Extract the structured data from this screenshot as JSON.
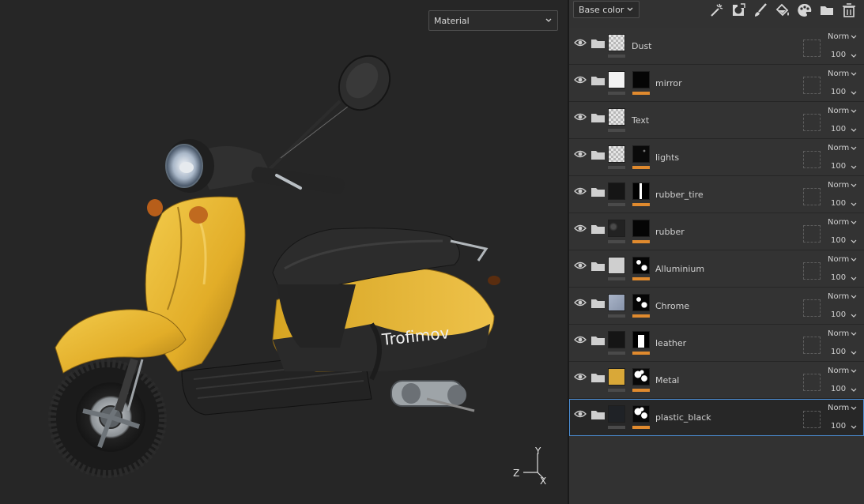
{
  "viewport": {
    "mode_dropdown": {
      "value": "Material"
    },
    "scene": {
      "brand_decal": "Trofimov",
      "colors": {
        "body": "#e7b52c",
        "body_shadow": "#b6861a",
        "seat": "#2c2c2c",
        "rubber": "#1d1d1d",
        "chrome": "#b7bcc2",
        "indicator": "#c0651b",
        "background": "#262626"
      }
    },
    "axis_gizmo": {
      "y_label": "Y",
      "z_label": "Z",
      "x_label": "X"
    }
  },
  "panel": {
    "channel_dropdown": {
      "value": "Base color"
    },
    "toolbar_icons": [
      "magic-wand-icon",
      "mask-icon",
      "paint-brush-icon",
      "fill-bucket-icon",
      "palette-icon",
      "folder-icon",
      "trash-icon"
    ],
    "accent_color": "#e08a2e",
    "selection_color": "#4b8bd0",
    "layers": [
      {
        "name": "Dust",
        "thumb": "checker",
        "mask": "none",
        "blend": "Norm",
        "opacity": "100"
      },
      {
        "name": "mirror",
        "thumb": "white",
        "mask": "black",
        "blend": "Norm",
        "opacity": "100"
      },
      {
        "name": "Text",
        "thumb": "checker",
        "mask": "none",
        "blend": "Norm",
        "opacity": "100"
      },
      {
        "name": "lights",
        "thumb": "checker",
        "mask": "dark-speck",
        "blend": "Norm",
        "opacity": "100"
      },
      {
        "name": "rubber_tire",
        "thumb": "dark",
        "mask": "white-line",
        "blend": "Norm",
        "opacity": "100"
      },
      {
        "name": "rubber",
        "thumb": "grunge",
        "mask": "black",
        "blend": "Norm",
        "opacity": "100"
      },
      {
        "name": "Alluminium",
        "thumb": "light-gray",
        "mask": "splotch",
        "blend": "Norm",
        "opacity": "100"
      },
      {
        "name": "Chrome",
        "thumb": "blue-gray",
        "mask": "splotch",
        "blend": "Norm",
        "opacity": "100"
      },
      {
        "name": "leather",
        "thumb": "dark",
        "mask": "white-block",
        "blend": "Norm",
        "opacity": "100"
      },
      {
        "name": "Metal",
        "thumb": "yellow",
        "mask": "splotch-heavy",
        "blend": "Norm",
        "opacity": "100"
      },
      {
        "name": "plastic_black",
        "thumb": "navy-dark",
        "mask": "splotch-heavy",
        "blend": "Norm",
        "opacity": "100",
        "selected": true
      }
    ]
  }
}
